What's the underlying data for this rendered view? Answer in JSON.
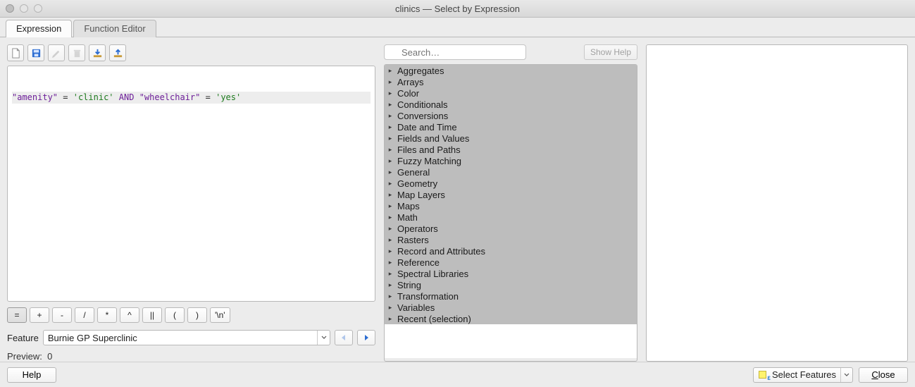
{
  "window": {
    "title": "clinics — Select by Expression"
  },
  "tabs": [
    {
      "label": "Expression",
      "active": true
    },
    {
      "label": "Function Editor",
      "active": false
    }
  ],
  "toolbar_icons": [
    "new-file-icon",
    "save-icon",
    "edit-icon",
    "delete-icon",
    "import-icon",
    "export-icon"
  ],
  "expression": {
    "f1": "\"amenity\"",
    "op1": "=",
    "s1": "'clinic'",
    "kw": "AND",
    "f2": "\"wheelchair\"",
    "op2": "=",
    "s2": "'yes'"
  },
  "operators": [
    "=",
    "+",
    "-",
    "/",
    "*",
    "^",
    "||",
    "(",
    ")",
    "'\\n'"
  ],
  "feature": {
    "label": "Feature",
    "value": "Burnie GP Superclinic"
  },
  "preview": {
    "label": "Preview:",
    "value": "0"
  },
  "search": {
    "placeholder": "Search…"
  },
  "show_help_label": "Show Help",
  "function_groups": [
    "Aggregates",
    "Arrays",
    "Color",
    "Conditionals",
    "Conversions",
    "Date and Time",
    "Fields and Values",
    "Files and Paths",
    "Fuzzy Matching",
    "General",
    "Geometry",
    "Map Layers",
    "Maps",
    "Math",
    "Operators",
    "Rasters",
    "Record and Attributes",
    "Reference",
    "Spectral Libraries",
    "String",
    "Transformation",
    "Variables",
    "Recent (selection)"
  ],
  "bottom": {
    "help": "Help",
    "select_features": "Select Features",
    "close": "Close"
  }
}
